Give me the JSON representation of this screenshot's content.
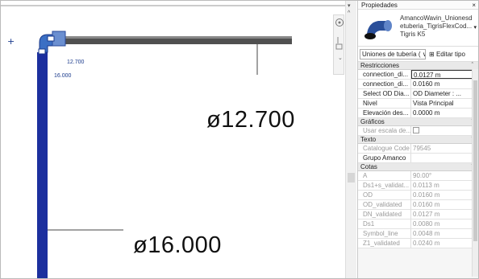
{
  "canvas": {
    "dim_small_1": "12.700",
    "dim_small_2": "16.000",
    "dim_large_1": "ø12.700",
    "dim_large_2": "ø16.000"
  },
  "properties": {
    "title": "Propiedades",
    "close": "×",
    "type_name": "AmancoWavin_Unionesd etuberia_TigrisFlexCod... Tigris K5",
    "category_selector": "Uniones de tubería ( ∨",
    "edit_type_label": "Editar tipo",
    "sections": [
      {
        "name": "Restricciones",
        "rows": [
          {
            "key": "connection_di...",
            "value": "0.0127 m"
          },
          {
            "key": "connection_di...",
            "value": "0.0160 m"
          },
          {
            "key": "Select OD Dia...",
            "value": "OD Diameter : ..."
          },
          {
            "key": "Nivel",
            "value": "Vista Principal"
          },
          {
            "key": "Elevación des...",
            "value": "0.0000 m"
          }
        ]
      },
      {
        "name": "Gráficos",
        "rows": [
          {
            "key": "Usar escala de...",
            "value": ""
          }
        ]
      },
      {
        "name": "Texto",
        "rows": [
          {
            "key": "Catalogue Code",
            "value": "79545"
          },
          {
            "key": "Grupo Amanco",
            "value": ""
          }
        ]
      },
      {
        "name": "Cotas",
        "rows": [
          {
            "key": "A",
            "value": "90.00°"
          },
          {
            "key": "Ds1+s_validat...",
            "value": "0.0113 m"
          },
          {
            "key": "OD",
            "value": "0.0160 m"
          },
          {
            "key": "OD_validated",
            "value": "0.0160 m"
          },
          {
            "key": "DN_validated",
            "value": "0.0127 m"
          },
          {
            "key": "Ds1",
            "value": "0.0080 m"
          },
          {
            "key": "Symbol_line",
            "value": "0.0048 m"
          },
          {
            "key": "Z1_validated",
            "value": "0.0240 m"
          }
        ]
      }
    ]
  },
  "colors": {
    "pipe_vertical": "#1c2f9e",
    "pipe_horizontal": "#555555",
    "fitting": "#3b6fc4"
  }
}
